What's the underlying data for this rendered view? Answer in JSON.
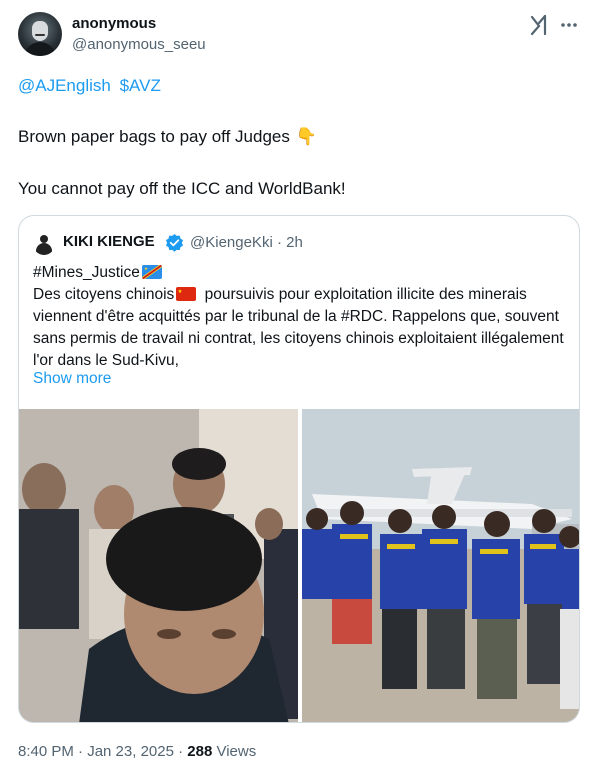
{
  "post": {
    "author_name": "anonymous",
    "author_handle": "@anonymous_seeu",
    "mentions": [
      "@AJEnglish",
      "$AVZ"
    ],
    "line1": "Brown paper bags to pay off Judges",
    "line2": "You cannot pay off the ICC and WorldBank!",
    "timestamp": "8:40 PM · Jan 23, 2025 · ",
    "views_count": "288",
    "views_label": "Views"
  },
  "quoted": {
    "author_name": "KIKI KIENGE",
    "author_handle": "@KiengeKki · 2h",
    "hashtag": "#Mines_Justice",
    "text_a": "Des citoyens chinois",
    "text_b": " poursuivis pour exploitation illicite des minerais viennent d'être acquittés par le tribunal de la #RDC. Rappelons que, souvent sans permis de travail ni contrat, les citoyens chinois exploitaient illégalement l'or dans le Sud-Kivu,",
    "show_more": "Show more"
  },
  "icons": {
    "grok": "grok-icon",
    "more": "more-icon",
    "verified": "verified-badge-icon",
    "pointing_down": "pointing-down-emoji",
    "flag_drc": "drc-flag-emoji",
    "flag_china": "china-flag-emoji"
  },
  "colors": {
    "link": "#1d9bf0",
    "text": "#0f1419",
    "muted": "#536471",
    "border": "#cfd9de"
  }
}
